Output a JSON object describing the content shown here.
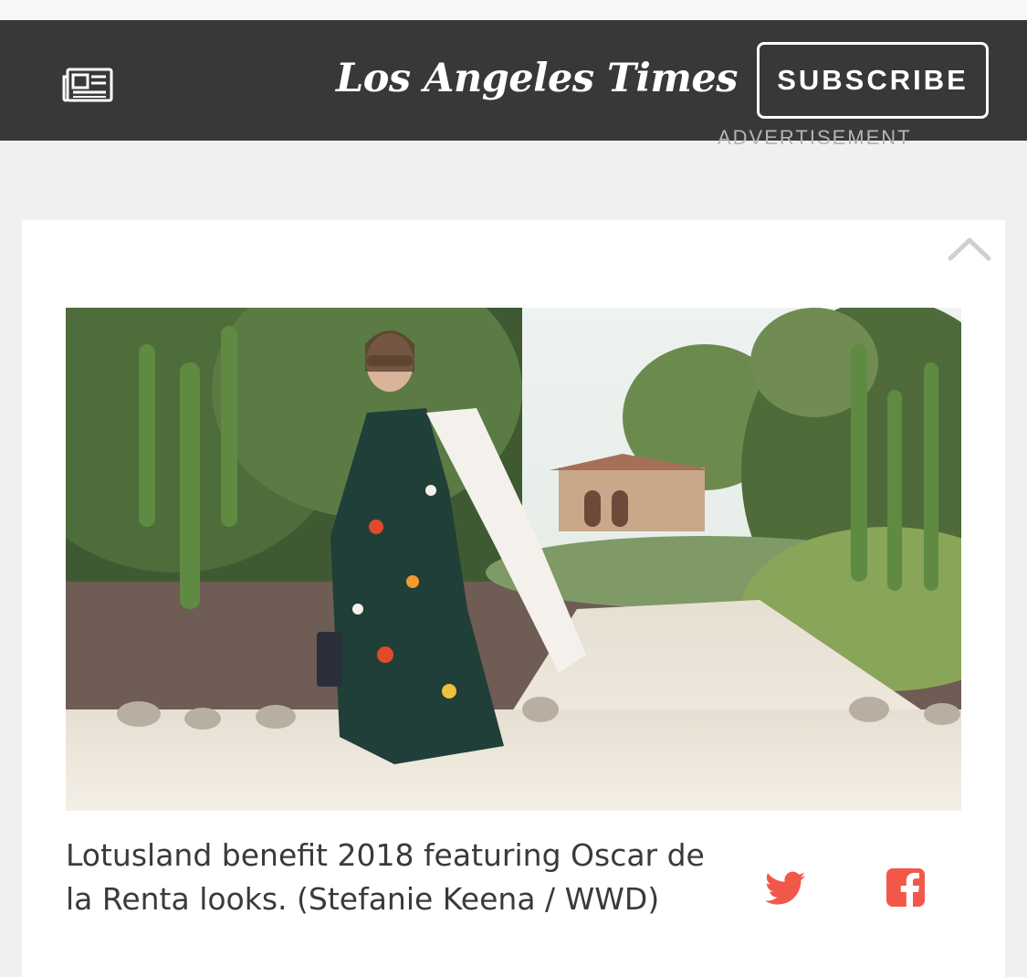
{
  "header": {
    "masthead": "Los Angeles Times",
    "subscribe_label": "SUBSCRIBE",
    "menu_icon": "newspaper-icon",
    "background": "#383838"
  },
  "ad": {
    "label": "ADVERTISEMENT"
  },
  "gallery": {
    "collapse_icon": "chevron-up-icon",
    "caption": "Lotusland benefit 2018 featuring Oscar de la Renta looks. (Stefanie Keena / WWD)",
    "share": {
      "twitter_icon": "twitter-icon",
      "facebook_icon": "facebook-icon",
      "accent": "#f2584a"
    }
  }
}
